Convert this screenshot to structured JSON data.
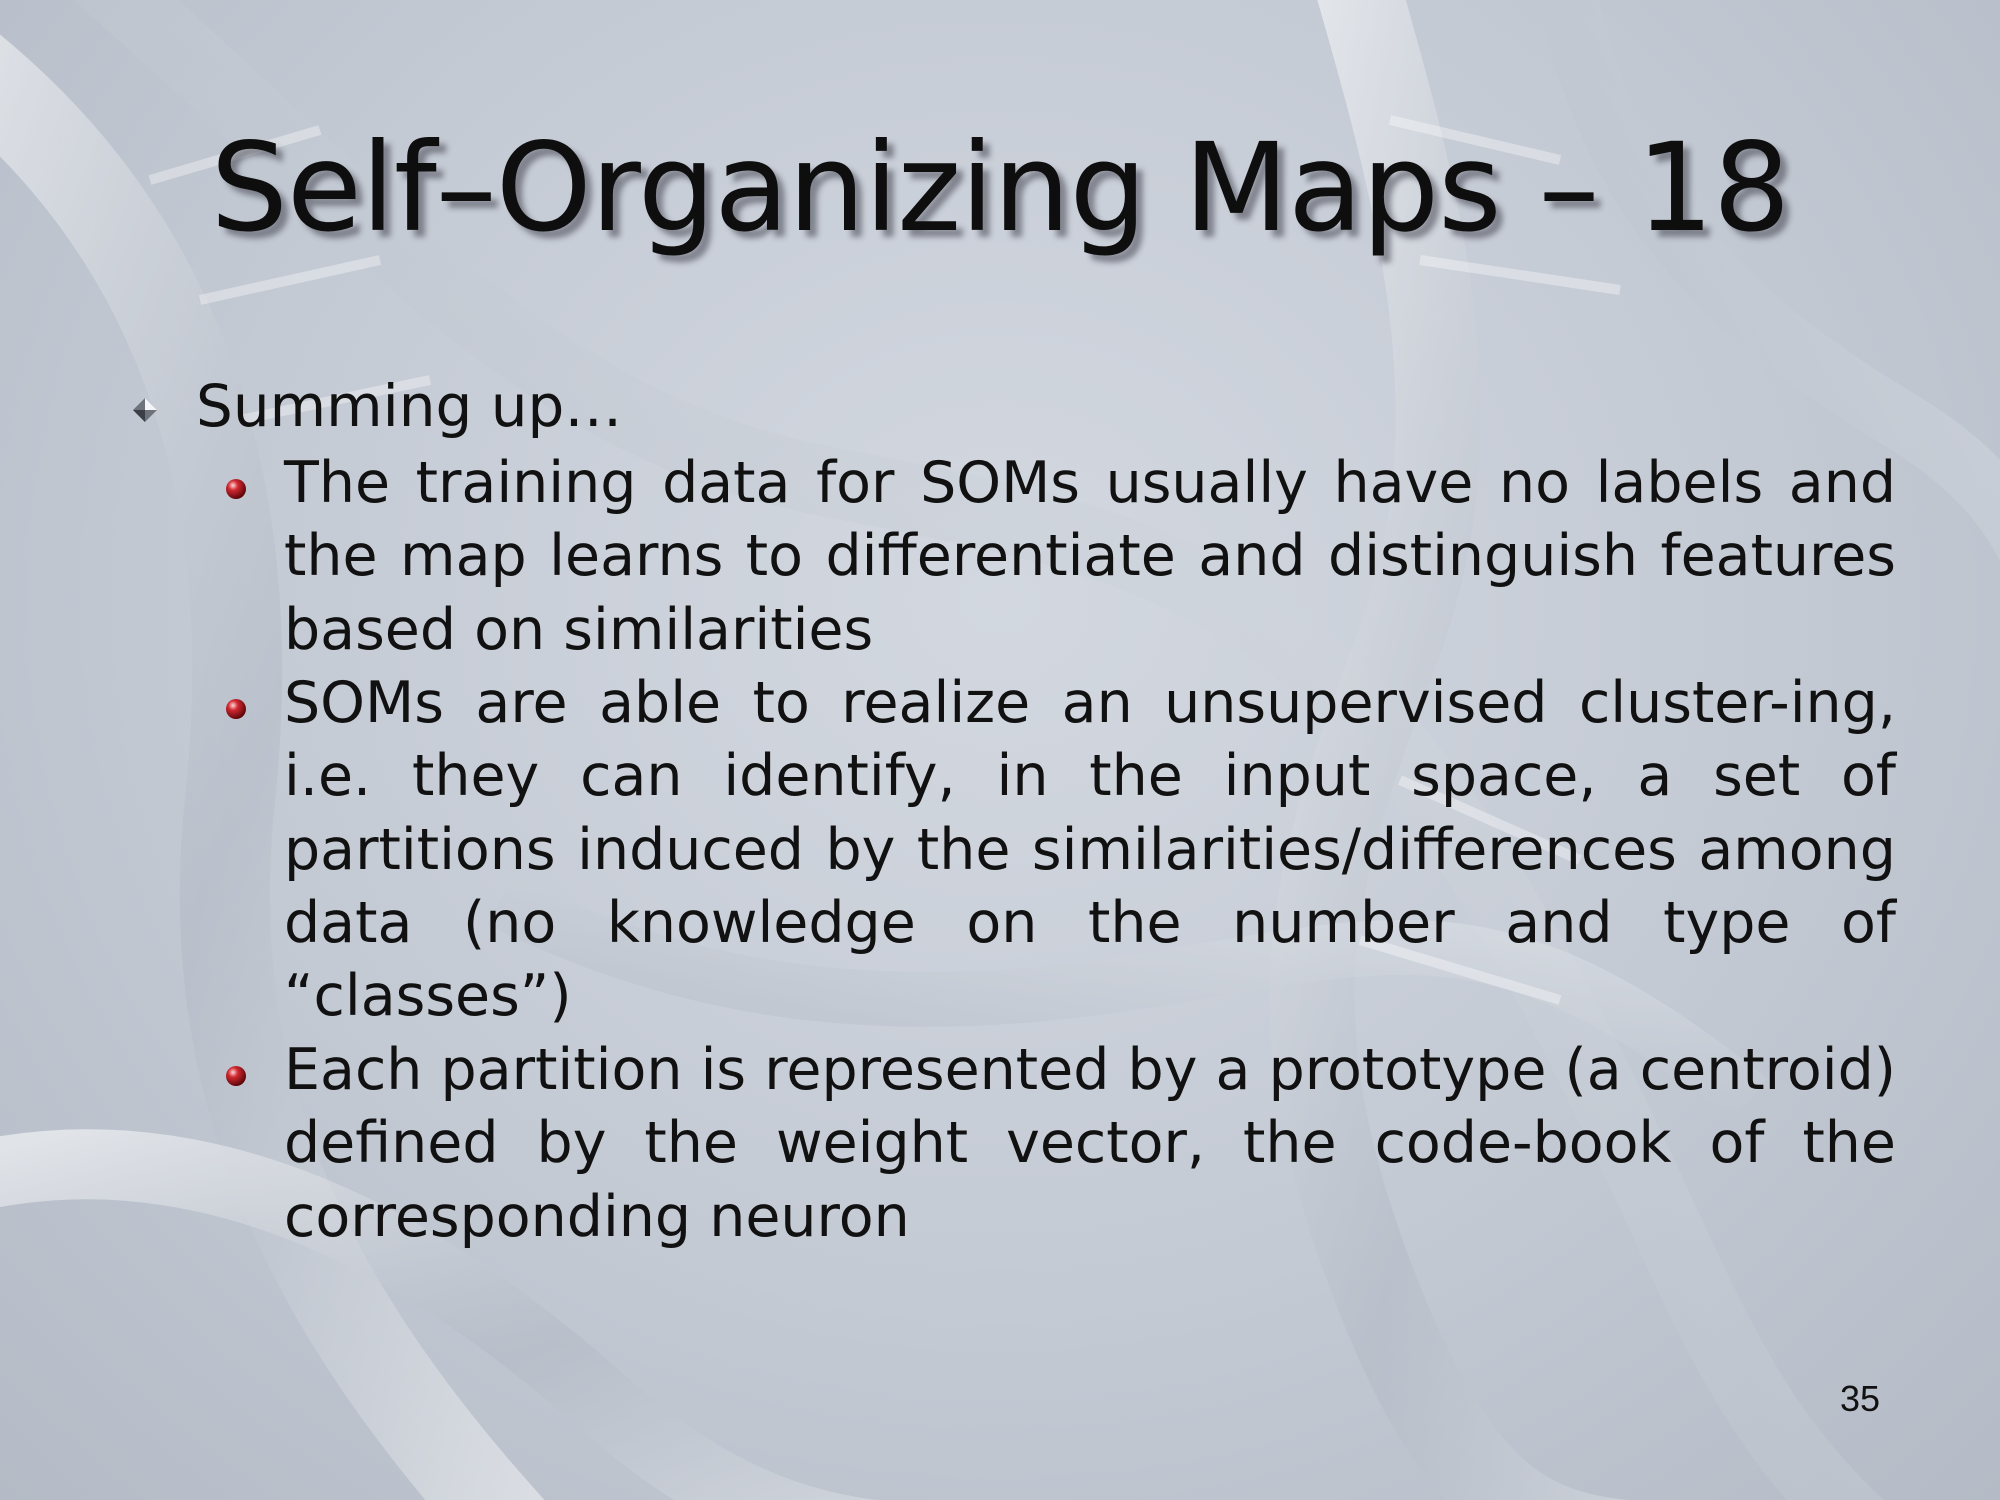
{
  "slide": {
    "title": "Self–Organizing Maps – 18",
    "heading": "Summing up…",
    "bullets": [
      "The training data for SOMs usually have no labels and the map learns to differentiate and distinguish features based on similarities",
      "SOMs are able to realize an unsupervised cluster-ing, i.e. they can identify, in the input space, a set of partitions induced by the similarities/differences among data (no knowledge on the number and type of “classes”)",
      "Each partition is represented by a prototype (a centroid) defined by the weight vector, the code-book of the corresponding neuron"
    ],
    "page_number": "35"
  },
  "icons": {
    "heading_bullet": "diamond-bullet-icon",
    "item_bullet": "red-ball-bullet-icon"
  },
  "colors": {
    "background": "#c4cad4",
    "text": "#111111",
    "bullet_red": "#a8141a"
  }
}
